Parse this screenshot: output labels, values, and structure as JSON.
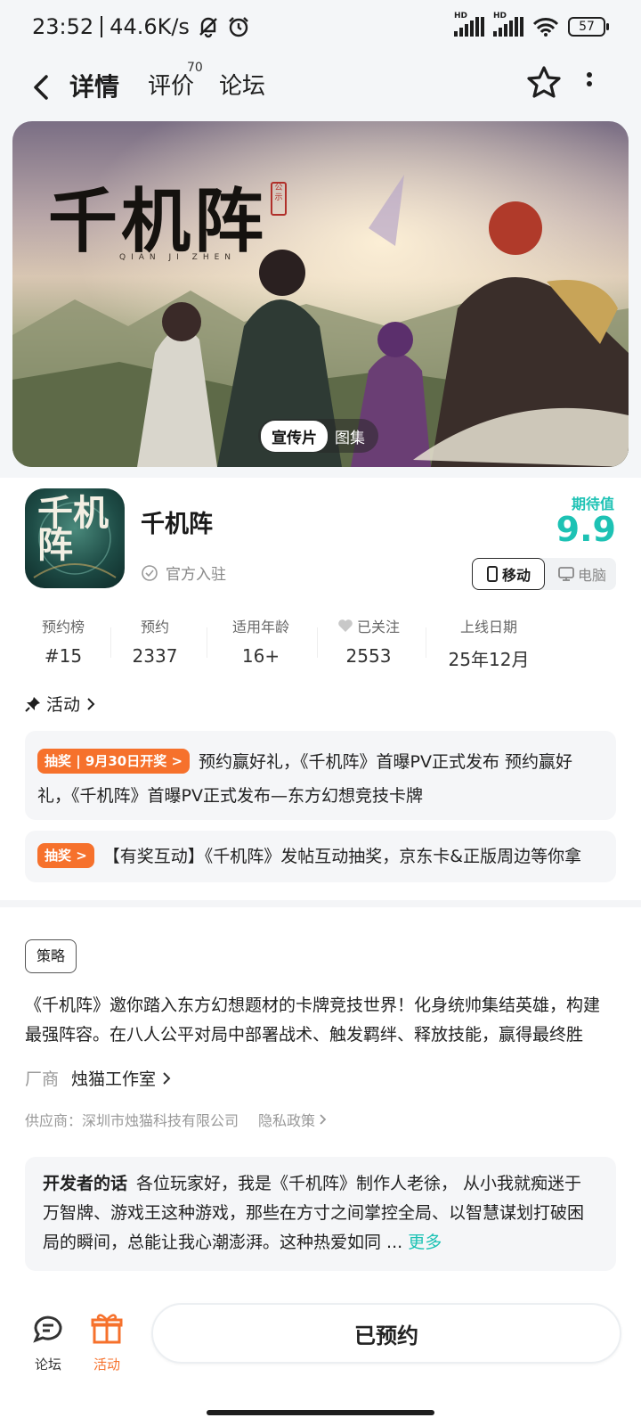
{
  "status": {
    "time": "23:52",
    "net_speed": "44.6K/s",
    "hd1": "HD",
    "hd2": "HD",
    "battery": "57"
  },
  "nav": {
    "tabs": [
      {
        "label": "详情"
      },
      {
        "label": "评价"
      },
      {
        "label": "论坛"
      }
    ],
    "review_count": "70"
  },
  "banner": {
    "logo": "千机阵",
    "logo_sub": "QIAN JI ZHEN",
    "seal": "公示",
    "media_tabs": [
      "宣传片",
      "图集"
    ]
  },
  "app": {
    "icon_text": "千机阵",
    "title": "千机阵",
    "official": "官方入驻",
    "expect_label": "期待值",
    "expect_value": "9.9",
    "platforms": [
      "移动",
      "电脑"
    ]
  },
  "stats": [
    {
      "label": "预约榜",
      "value": "#15"
    },
    {
      "label": "预约",
      "value": "2337"
    },
    {
      "label": "适用年龄",
      "value": "16+"
    },
    {
      "label": "已关注",
      "value": "2553"
    },
    {
      "label": "上线日期",
      "value": "25年12月"
    }
  ],
  "activity": {
    "header": "活动",
    "items": [
      {
        "tag": "抽奖 | 9月30日开奖 >",
        "text": "预约赢好礼，《千机阵》首曝PV正式发布 预约赢好礼，《千机阵》首曝PV正式发布—东方幻想竞技卡牌"
      },
      {
        "tag": "抽奖 >",
        "text": "【有奖互动】《千机阵》发帖互动抽奖，京东卡&正版周边等你拿"
      }
    ]
  },
  "strategy_tag": "策略",
  "description": "《千机阵》邀你踏入东方幻想题材的卡牌竞技世界！化身统帅集结英雄，构建最强阵容。在八人公平对局中部署战术、触发羁绊、释放技能，赢得最终胜利！",
  "vendor": {
    "key": "厂商",
    "value": "烛猫工作室"
  },
  "supplier": {
    "text": "供应商：深圳市烛猫科技有限公司",
    "privacy": "隐私政策"
  },
  "developer": {
    "label": "开发者的话",
    "text": "各位玩家好，我是《千机阵》制作人老徐， 从小我就痴迷于万智牌、游戏王这种游戏，那些在方寸之间掌控全局、以智慧谋划打破困局的瞬间，总能让我心潮澎湃。这种热爱如同 ...",
    "more": "更多"
  },
  "bottom": {
    "forum": "论坛",
    "activity": "活动",
    "reserve": "已预约"
  },
  "colors": {
    "accent": "#1dc2b4",
    "orange": "#f6712c"
  }
}
